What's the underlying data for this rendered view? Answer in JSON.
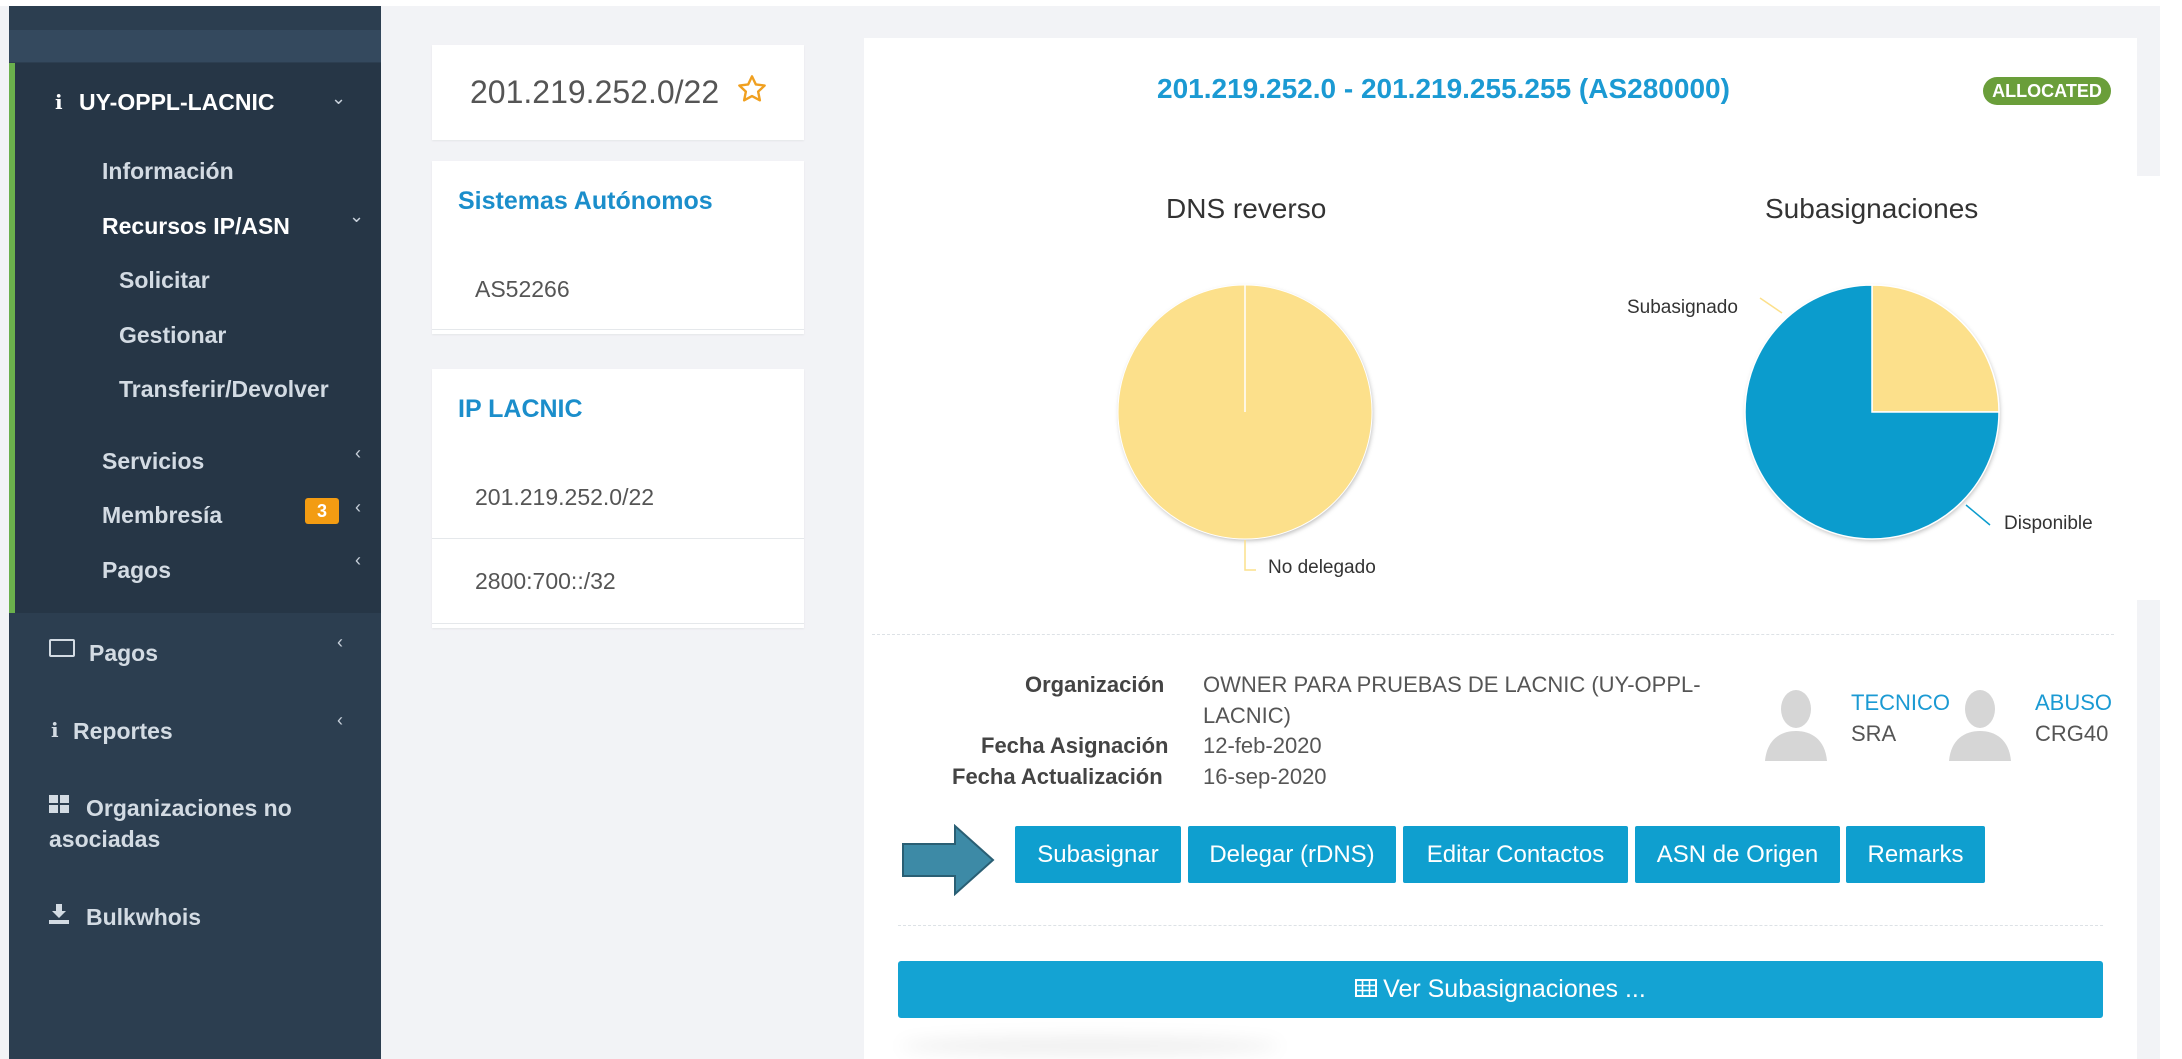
{
  "sidebar": {
    "org": "UY-OPPL-LACNIC",
    "items": [
      {
        "label": "Información"
      },
      {
        "label": "Recursos IP/ASN"
      },
      {
        "label": "Solicitar"
      },
      {
        "label": "Gestionar"
      },
      {
        "label": "Transferir/Devolver"
      },
      {
        "label": "Servicios"
      },
      {
        "label": "Membresía",
        "badge": "3"
      },
      {
        "label": "Pagos"
      }
    ],
    "sections": [
      {
        "label": "Pagos",
        "icon": "money-icon"
      },
      {
        "label": "Reportes",
        "icon": "info-icon"
      },
      {
        "label": "Organizaciones no asociadas",
        "line1": "Organizaciones no",
        "line2": "asociadas",
        "icon": "grid-icon"
      },
      {
        "label": "Bulkwhois",
        "icon": "download-icon"
      }
    ]
  },
  "resource": {
    "prefix": "201.219.252.0/22"
  },
  "asn_card": {
    "title": "Sistemas Autónomos",
    "items": [
      "AS52266"
    ]
  },
  "ip_card": {
    "title": "IP LACNIC",
    "items": [
      "201.219.252.0/22",
      "2800:700::/32"
    ]
  },
  "detail": {
    "range": "201.219.252.0 - 201.219.255.255 (AS280000)",
    "status": "ALLOCATED",
    "charts": [
      {
        "title": "DNS reverso",
        "labels": [
          "No delegado"
        ]
      },
      {
        "title": "Subasignaciones",
        "labels": [
          "Subasignado",
          "Disponible"
        ]
      }
    ],
    "info": {
      "org_label": "Organización",
      "org_value_l1": "OWNER PARA PRUEBAS DE LACNIC (UY-OPPL-",
      "org_value_l2": "LACNIC)",
      "date_label": "Fecha Asignación",
      "date_value": "12-feb-2020",
      "update_label": "Fecha Actualización",
      "update_value": "16-sep-2020"
    },
    "contacts": [
      {
        "role": "TECNICO",
        "handle": "SRA"
      },
      {
        "role": "ABUSO",
        "handle": "CRG40"
      }
    ],
    "buttons": [
      "Subasignar",
      "Delegar (rDNS)",
      "Editar Contactos",
      "ASN de Origen",
      "Remarks"
    ],
    "view_button": "Ver Subasignaciones ..."
  },
  "chart_data": [
    {
      "type": "pie",
      "title": "DNS reverso",
      "categories": [
        "No delegado"
      ],
      "values": [
        100
      ],
      "colors": [
        "#fce08b"
      ]
    },
    {
      "type": "pie",
      "title": "Subasignaciones",
      "categories": [
        "Subasignado",
        "Disponible"
      ],
      "values": [
        25,
        75
      ],
      "colors": [
        "#fce08b",
        "#0b9ccd"
      ]
    }
  ],
  "colors": {
    "sidebar": "#2c3e50",
    "accent": "#1b9ad3",
    "button": "#0f9fcf",
    "allocated": "#6a9e3a",
    "badge": "#f39c12",
    "active_bar": "#6ab04c"
  }
}
